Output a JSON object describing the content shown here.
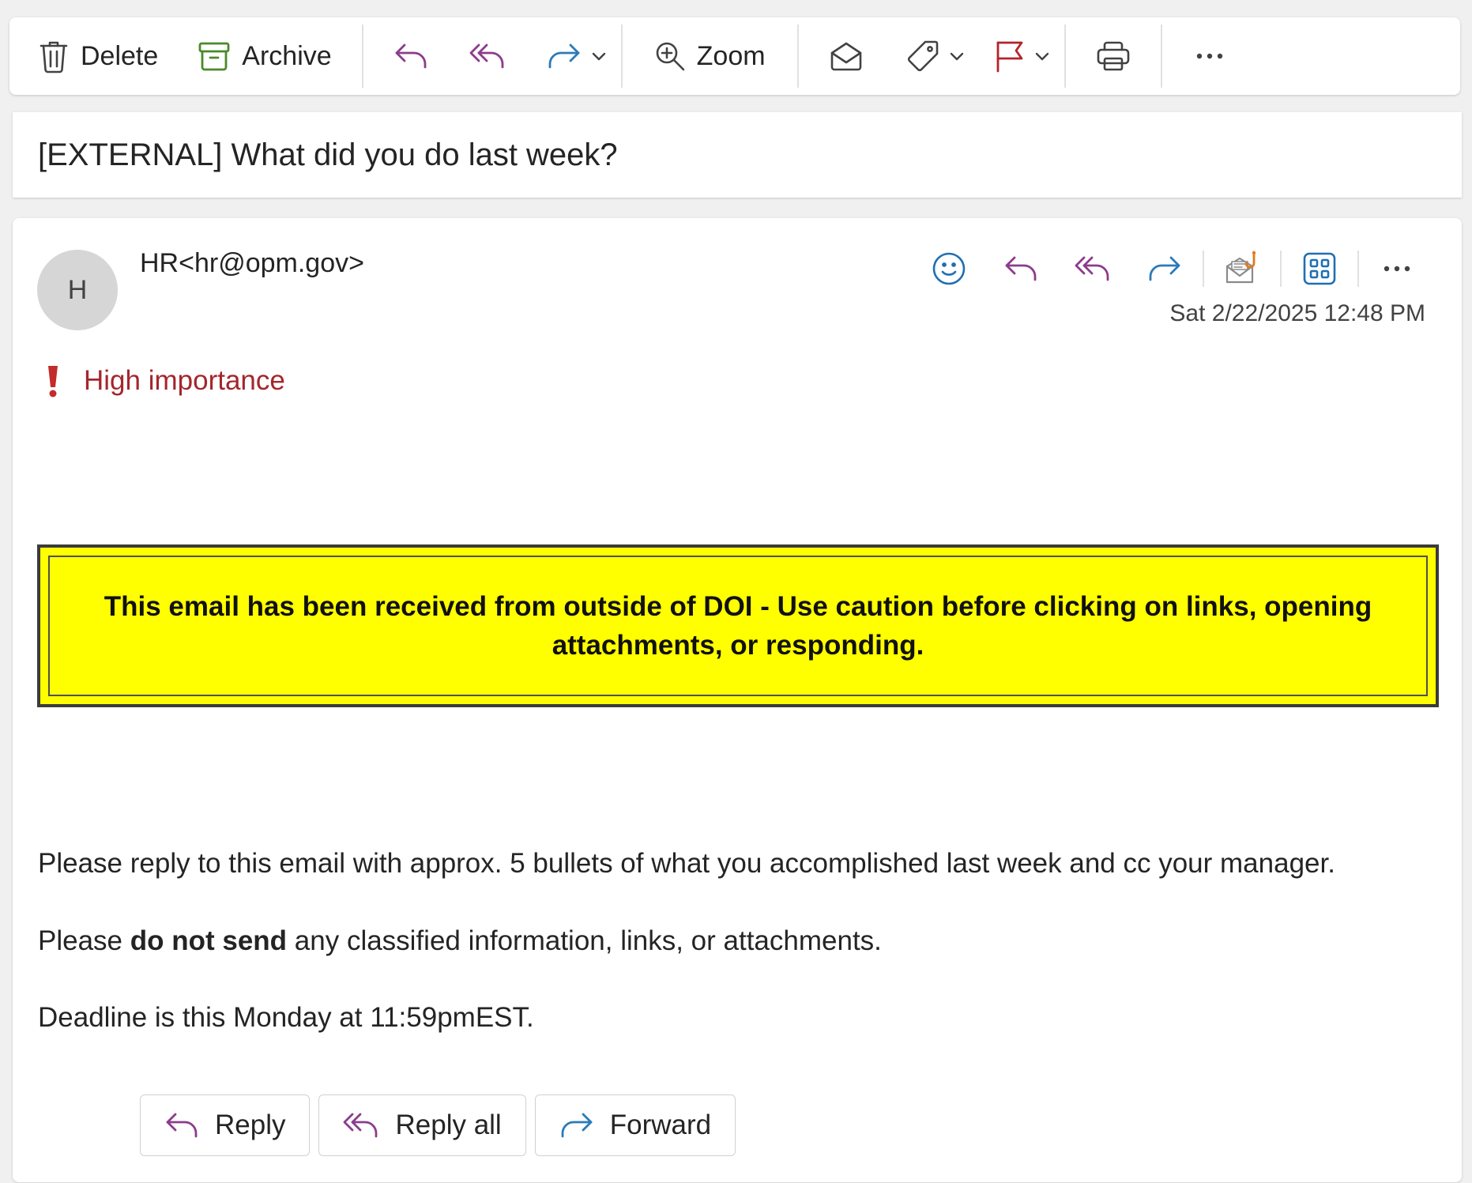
{
  "toolbar": {
    "delete_label": "Delete",
    "archive_label": "Archive",
    "zoom_label": "Zoom",
    "icons": [
      "trash-icon",
      "archive-icon",
      "reply-icon",
      "reply-all-icon",
      "forward-icon",
      "zoom-in-icon",
      "envelope-open-icon",
      "tag-icon",
      "flag-icon",
      "printer-icon",
      "more-icon"
    ]
  },
  "subject": "[EXTERNAL] What did you do last week?",
  "message": {
    "avatar_initial": "H",
    "sender": "HR<hr@opm.gov>",
    "timestamp": "Sat 2/22/2025 12:48 PM",
    "importance": "High importance",
    "warning": "This email has been received from outside of DOI - Use caution before clicking on links, opening attachments, or responding.",
    "body": {
      "p1": "Please reply to this email with approx. 5 bullets of what you accomplished last week and cc your manager.",
      "p2_before": "Please ",
      "p2_bold": "do not send",
      "p2_after": " any classified information, links, or attachments.",
      "p3": "Deadline is this Monday at 11:59pmEST."
    }
  },
  "actions": {
    "reply": "Reply",
    "reply_all": "Reply all",
    "forward": "Forward"
  },
  "colors": {
    "reply_purple": "#8c3c8c",
    "forward_blue": "#2b7bb9",
    "archive_green": "#4a8a2a",
    "flag_red": "#b4232a",
    "importance_red": "#a4262c",
    "warning_yellow": "#ffff00"
  }
}
